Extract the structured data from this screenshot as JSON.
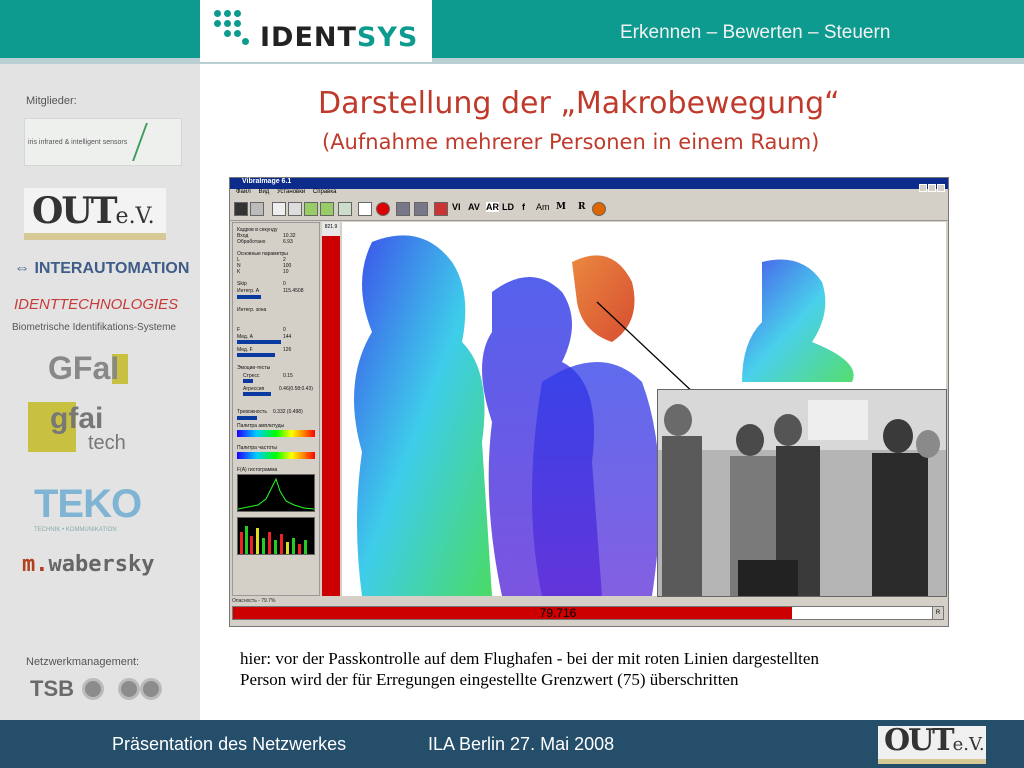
{
  "header": {
    "logo_part1": "IDENT",
    "logo_part2": "SYS",
    "tagline": "Erkennen – Bewerten – Steuern"
  },
  "slide": {
    "title": "Darstellung der „Makrobewegung“",
    "subtitle": "(Aufnahme mehrerer Personen in einem Raum)"
  },
  "sidebar": {
    "members_label": "Mitglieder:",
    "logos": {
      "iris": "iris  infrared & intelligent sensors",
      "out": "OUT",
      "out_suffix": "e.V.",
      "interautomation": "INTERAUTOMATION",
      "identtech": "IDENTTECHNOLOGIES",
      "identtech_sub": "Biometrische Identifikations-Systeme",
      "gfal": "GFaI",
      "gfai_1": "gfai",
      "gfai_2": "tech",
      "teko": "TEKO",
      "teko_sub": "TECHNIK • KOMMUNIKATION",
      "wabersky_m": "m.",
      "wabersky_rest": "wabersky",
      "tsb": "TSB"
    },
    "network_label": "Netzwerkmanagement:"
  },
  "app": {
    "window_title": "VibraImage 6.1",
    "menu": [
      "Файл",
      "Вид",
      "Установки",
      "Справка"
    ],
    "toolbar_text_buttons": [
      "VI",
      "AV",
      "AR",
      "LD",
      "f",
      "Am",
      "M",
      "R"
    ],
    "panel": {
      "r1": "Кадров в секунду",
      "r2": "Вход",
      "r2v": "10.32",
      "r3": "Обработано",
      "r3v": "6.93",
      "r4": "Основные параметры",
      "r5": "L",
      "r5v": "2",
      "r6": "N",
      "r6v": "100",
      "r7": "K",
      "r7v": "10",
      "r8": "Skip",
      "r8v": "0",
      "r9": "Интегр. A",
      "r9v": "115.4508",
      "r10": "Интегр. зона",
      "r11": "F",
      "r11v": "0",
      "r12": "Мед. A",
      "r12v": "144",
      "r13": "Мед. F",
      "r13v": "126",
      "r14": "Эмоции-тесты",
      "r15": "Стресс",
      "r15v": "0.15",
      "r16": "Агрессия",
      "r16v": "0.46(0.58:0.43)",
      "r17": "Тревожность",
      "r17v": "0.332 (0.498)",
      "r18": "Палитра амплитуды",
      "r19": "Палитра частоты",
      "r20": "F(A) гистограмма"
    },
    "strip_top": "821.9",
    "status_label": "Опасность - 79.7%",
    "status_value": "79.716",
    "status_fraction": 0.797,
    "status_button": "R"
  },
  "caption": {
    "line1": "hier: vor der Passkontrolle auf dem Flughafen - bei der mit roten Linien dargestellten",
    "line2": "Person wird der für Erregungen eingestellte Grenzwert (75) überschritten"
  },
  "footer": {
    "left": "Präsentation des Netzwerkes",
    "right": "ILA Berlin  27. Mai 2008",
    "logo": "OUT",
    "logo_suffix": "e.V."
  },
  "colors": {
    "teal": "#0d9a8f",
    "title_red": "#c03a2b",
    "footer_blue": "#244e6a",
    "alarm_red": "#cc0000"
  }
}
